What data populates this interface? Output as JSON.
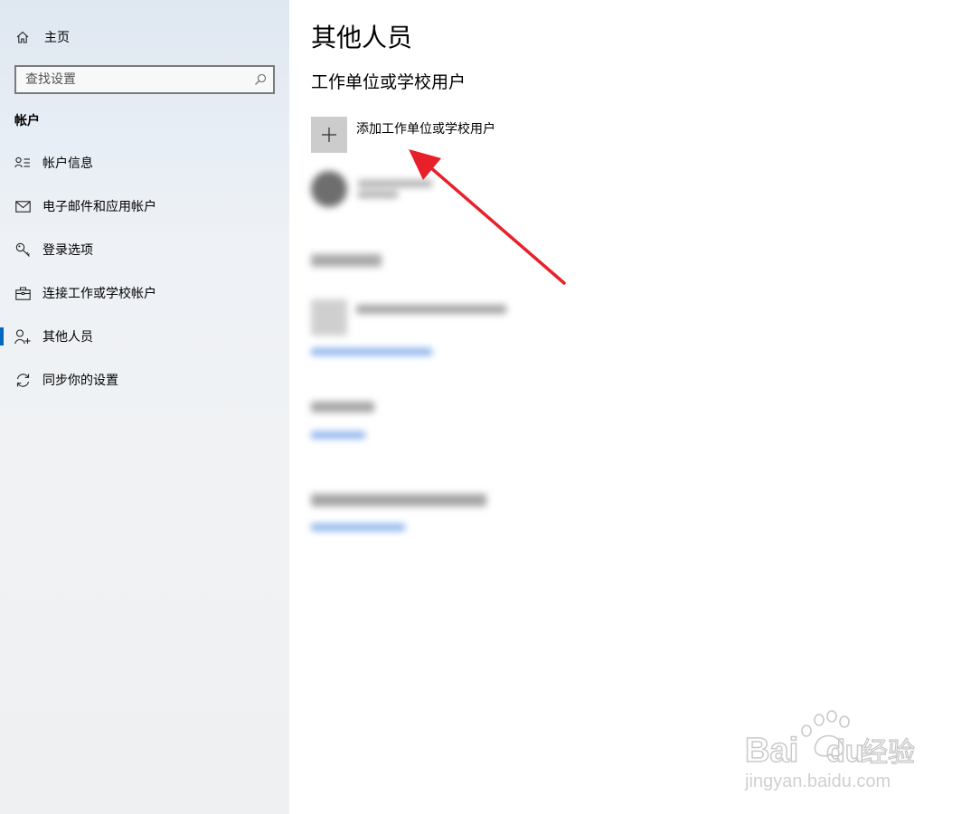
{
  "sidebar": {
    "home_label": "主页",
    "search_placeholder": "查找设置",
    "section_title": "帐户",
    "items": [
      {
        "label": "帐户信息",
        "icon": "account-info-icon"
      },
      {
        "label": "电子邮件和应用帐户",
        "icon": "mail-icon"
      },
      {
        "label": "登录选项",
        "icon": "key-icon"
      },
      {
        "label": "连接工作或学校帐户",
        "icon": "briefcase-icon"
      },
      {
        "label": "其他人员",
        "icon": "person-add-icon",
        "active": true
      },
      {
        "label": "同步你的设置",
        "icon": "sync-icon"
      }
    ]
  },
  "main": {
    "title": "其他人员",
    "subtitle": "工作单位或学校用户",
    "add_label": "添加工作单位或学校用户"
  },
  "colors": {
    "accent": "#0067c0",
    "arrow": "#e8202a",
    "tile": "#cccccc"
  },
  "watermark": {
    "brand": "Bai",
    "brand2": "du",
    "brand_cn": "经验",
    "url": "jingyan.baidu.com"
  }
}
